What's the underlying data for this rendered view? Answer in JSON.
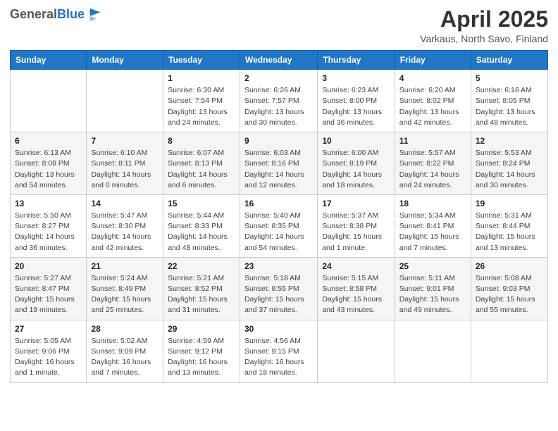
{
  "header": {
    "logo_general": "General",
    "logo_blue": "Blue",
    "main_title": "April 2025",
    "subtitle": "Varkaus, North Savo, Finland"
  },
  "weekdays": [
    "Sunday",
    "Monday",
    "Tuesday",
    "Wednesday",
    "Thursday",
    "Friday",
    "Saturday"
  ],
  "weeks": [
    [
      {
        "day": "",
        "info": ""
      },
      {
        "day": "",
        "info": ""
      },
      {
        "day": "1",
        "info": "Sunrise: 6:30 AM\nSunset: 7:54 PM\nDaylight: 13 hours\nand 24 minutes."
      },
      {
        "day": "2",
        "info": "Sunrise: 6:26 AM\nSunset: 7:57 PM\nDaylight: 13 hours\nand 30 minutes."
      },
      {
        "day": "3",
        "info": "Sunrise: 6:23 AM\nSunset: 8:00 PM\nDaylight: 13 hours\nand 36 minutes."
      },
      {
        "day": "4",
        "info": "Sunrise: 6:20 AM\nSunset: 8:02 PM\nDaylight: 13 hours\nand 42 minutes."
      },
      {
        "day": "5",
        "info": "Sunrise: 6:16 AM\nSunset: 8:05 PM\nDaylight: 13 hours\nand 48 minutes."
      }
    ],
    [
      {
        "day": "6",
        "info": "Sunrise: 6:13 AM\nSunset: 8:08 PM\nDaylight: 13 hours\nand 54 minutes."
      },
      {
        "day": "7",
        "info": "Sunrise: 6:10 AM\nSunset: 8:11 PM\nDaylight: 14 hours\nand 0 minutes."
      },
      {
        "day": "8",
        "info": "Sunrise: 6:07 AM\nSunset: 8:13 PM\nDaylight: 14 hours\nand 6 minutes."
      },
      {
        "day": "9",
        "info": "Sunrise: 6:03 AM\nSunset: 8:16 PM\nDaylight: 14 hours\nand 12 minutes."
      },
      {
        "day": "10",
        "info": "Sunrise: 6:00 AM\nSunset: 8:19 PM\nDaylight: 14 hours\nand 18 minutes."
      },
      {
        "day": "11",
        "info": "Sunrise: 5:57 AM\nSunset: 8:22 PM\nDaylight: 14 hours\nand 24 minutes."
      },
      {
        "day": "12",
        "info": "Sunrise: 5:53 AM\nSunset: 8:24 PM\nDaylight: 14 hours\nand 30 minutes."
      }
    ],
    [
      {
        "day": "13",
        "info": "Sunrise: 5:50 AM\nSunset: 8:27 PM\nDaylight: 14 hours\nand 36 minutes."
      },
      {
        "day": "14",
        "info": "Sunrise: 5:47 AM\nSunset: 8:30 PM\nDaylight: 14 hours\nand 42 minutes."
      },
      {
        "day": "15",
        "info": "Sunrise: 5:44 AM\nSunset: 8:33 PM\nDaylight: 14 hours\nand 48 minutes."
      },
      {
        "day": "16",
        "info": "Sunrise: 5:40 AM\nSunset: 8:35 PM\nDaylight: 14 hours\nand 54 minutes."
      },
      {
        "day": "17",
        "info": "Sunrise: 5:37 AM\nSunset: 8:38 PM\nDaylight: 15 hours\nand 1 minute."
      },
      {
        "day": "18",
        "info": "Sunrise: 5:34 AM\nSunset: 8:41 PM\nDaylight: 15 hours\nand 7 minutes."
      },
      {
        "day": "19",
        "info": "Sunrise: 5:31 AM\nSunset: 8:44 PM\nDaylight: 15 hours\nand 13 minutes."
      }
    ],
    [
      {
        "day": "20",
        "info": "Sunrise: 5:27 AM\nSunset: 8:47 PM\nDaylight: 15 hours\nand 19 minutes."
      },
      {
        "day": "21",
        "info": "Sunrise: 5:24 AM\nSunset: 8:49 PM\nDaylight: 15 hours\nand 25 minutes."
      },
      {
        "day": "22",
        "info": "Sunrise: 5:21 AM\nSunset: 8:52 PM\nDaylight: 15 hours\nand 31 minutes."
      },
      {
        "day": "23",
        "info": "Sunrise: 5:18 AM\nSunset: 8:55 PM\nDaylight: 15 hours\nand 37 minutes."
      },
      {
        "day": "24",
        "info": "Sunrise: 5:15 AM\nSunset: 8:58 PM\nDaylight: 15 hours\nand 43 minutes."
      },
      {
        "day": "25",
        "info": "Sunrise: 5:11 AM\nSunset: 9:01 PM\nDaylight: 15 hours\nand 49 minutes."
      },
      {
        "day": "26",
        "info": "Sunrise: 5:08 AM\nSunset: 9:03 PM\nDaylight: 15 hours\nand 55 minutes."
      }
    ],
    [
      {
        "day": "27",
        "info": "Sunrise: 5:05 AM\nSunset: 9:06 PM\nDaylight: 16 hours\nand 1 minute."
      },
      {
        "day": "28",
        "info": "Sunrise: 5:02 AM\nSunset: 9:09 PM\nDaylight: 16 hours\nand 7 minutes."
      },
      {
        "day": "29",
        "info": "Sunrise: 4:59 AM\nSunset: 9:12 PM\nDaylight: 16 hours\nand 13 minutes."
      },
      {
        "day": "30",
        "info": "Sunrise: 4:56 AM\nSunset: 9:15 PM\nDaylight: 16 hours\nand 18 minutes."
      },
      {
        "day": "",
        "info": ""
      },
      {
        "day": "",
        "info": ""
      },
      {
        "day": "",
        "info": ""
      }
    ]
  ]
}
